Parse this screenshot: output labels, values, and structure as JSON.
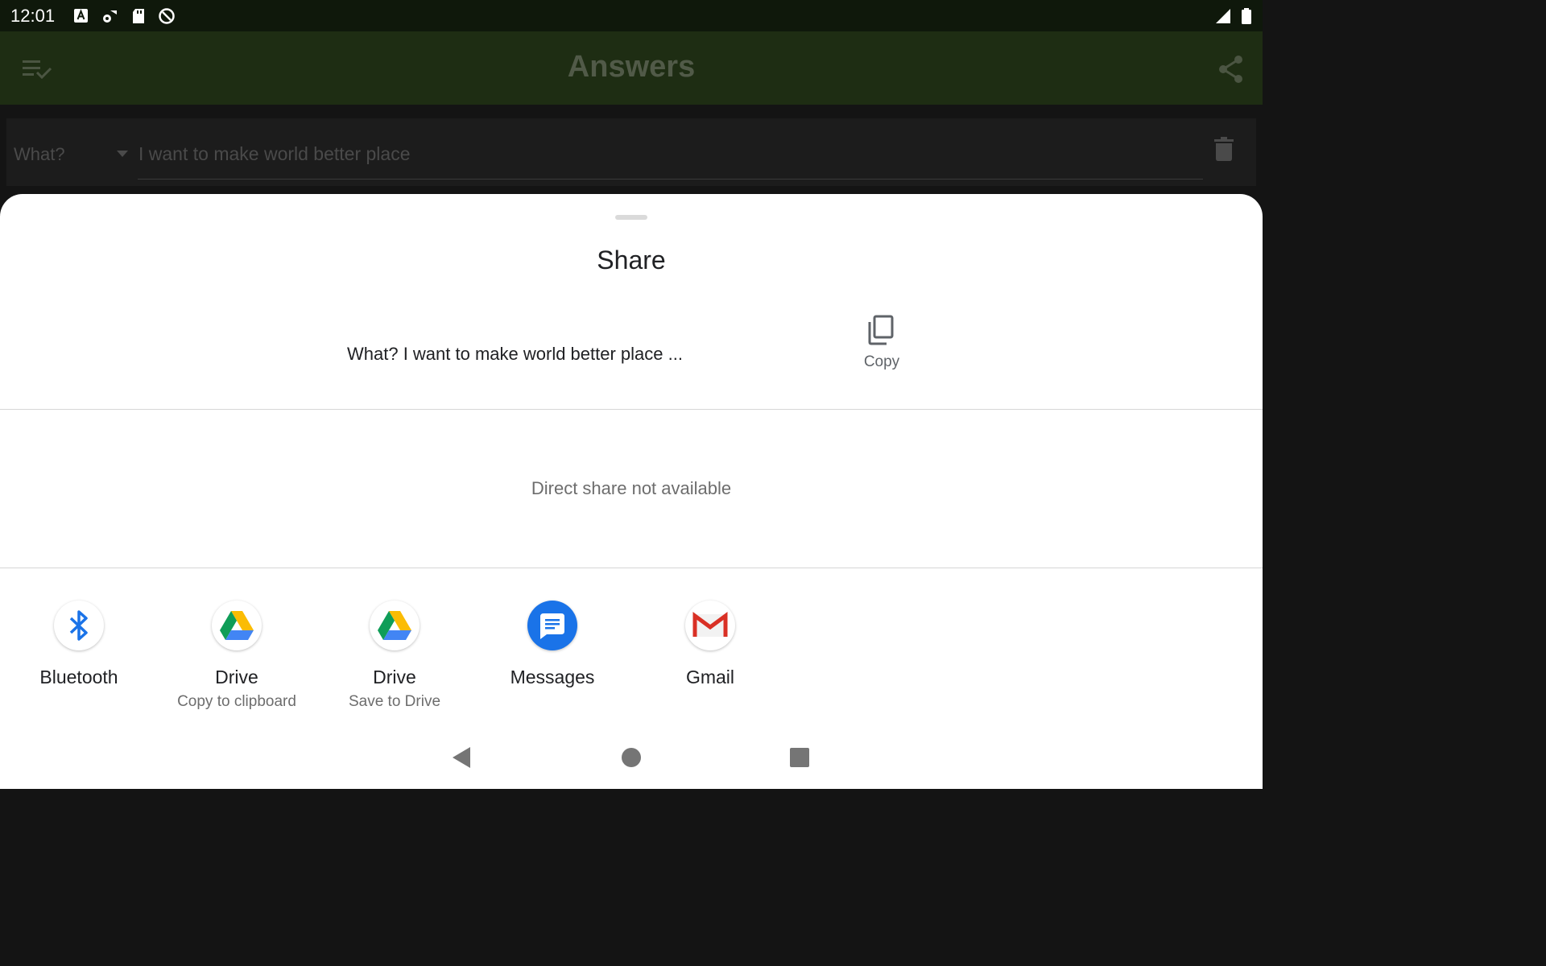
{
  "status_bar": {
    "time": "12:01"
  },
  "app_bar": {
    "title": "Answers"
  },
  "question": {
    "label": "What?",
    "text": "I want to make world better place"
  },
  "share_sheet": {
    "title": "Share",
    "preview_text": "What? I want to make world better place ...",
    "copy_label": "Copy",
    "direct_share_message": "Direct share not available",
    "targets": [
      {
        "name": "Bluetooth",
        "subtitle": ""
      },
      {
        "name": "Drive",
        "subtitle": "Copy to clipboard"
      },
      {
        "name": "Drive",
        "subtitle": "Save to Drive"
      },
      {
        "name": "Messages",
        "subtitle": ""
      },
      {
        "name": "Gmail",
        "subtitle": ""
      }
    ]
  },
  "colors": {
    "status_bar_bg": "#0f180b",
    "app_bar_bg": "#1e2d13",
    "sheet_bg": "#ffffff",
    "messages_blue": "#1a73e8",
    "gmail_red": "#d93025"
  },
  "icons": {
    "app_bar_left": "playlist-check-icon",
    "app_bar_right": "share-icon",
    "question_delete": "trash-icon",
    "copy": "copy-icon",
    "nav": [
      "back-icon",
      "home-icon",
      "recents-icon"
    ]
  }
}
